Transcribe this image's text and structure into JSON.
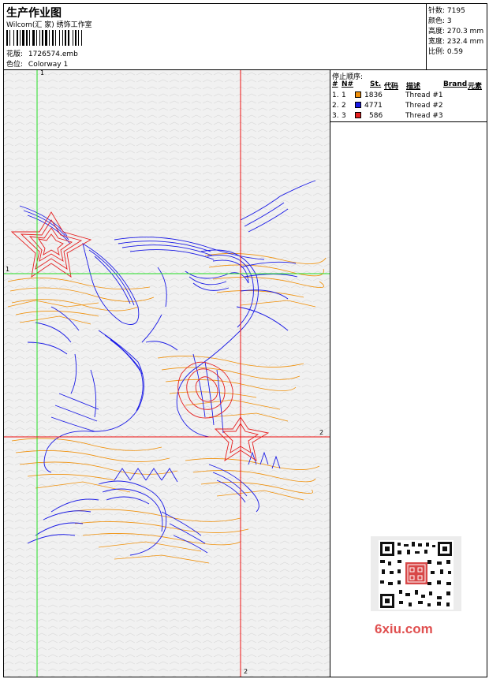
{
  "header": {
    "title": "生产作业图",
    "company": "Wilcom(汇 家) 绣饰工作室",
    "design_label": "花版:",
    "design_value": "1726574.emb",
    "colorway_label": "色位:",
    "colorway_value": "Colorway 1"
  },
  "stats": {
    "stitches_label": "针数:",
    "stitches_value": "7195",
    "colors_label": "颜色:",
    "colors_value": "3",
    "height_label": "高度:",
    "height_value": "270.3 mm",
    "width_label": "宽度:",
    "width_value": "232.4 mm",
    "ratio_label": "比例:",
    "ratio_value": "0.59"
  },
  "stop_sequence": {
    "title": "停止顺序:",
    "columns": [
      "#",
      "N#",
      "St.",
      "代码",
      "描述",
      "Brand",
      "元素"
    ],
    "rows": [
      {
        "num": "1.",
        "needle": "1",
        "stitches": "1836",
        "color": "#f0900a",
        "description": "Thread #1"
      },
      {
        "num": "2.",
        "needle": "2",
        "stitches": "4771",
        "color": "#1a1ae6",
        "description": "Thread #2"
      },
      {
        "num": "3.",
        "needle": "3",
        "stitches": "586",
        "color": "#e62020",
        "description": "Thread #3"
      }
    ]
  },
  "guides": {
    "v1_label": "1",
    "v2_label": "2",
    "h1_label": "1",
    "h2_label": "2",
    "v_guide_color": "#22dd22",
    "h_guide_color": "#ee1111"
  },
  "watermark": {
    "text": "6xiu.com",
    "text_color": "#e05050"
  }
}
